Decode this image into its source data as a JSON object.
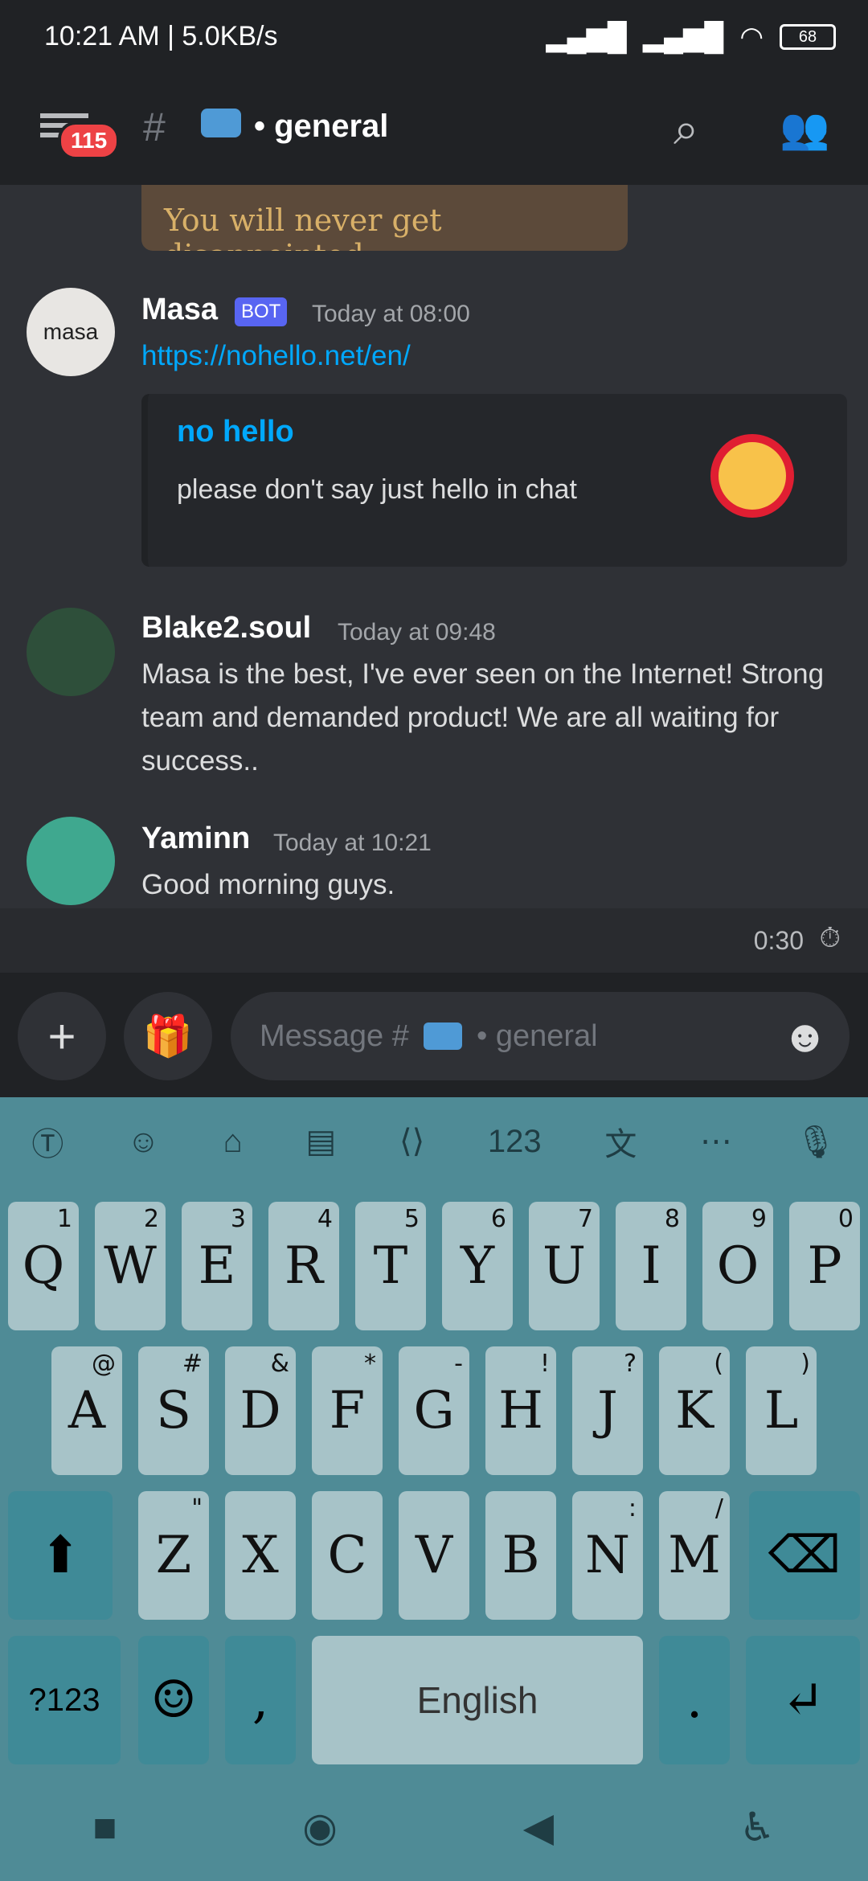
{
  "status": {
    "time": "10:21 AM | 5.0KB/s",
    "battery": "68"
  },
  "appbar": {
    "notification_count": "115",
    "channel": "• general"
  },
  "messages": [
    {
      "image_caption": "You will never get disappointed"
    },
    {
      "author": "Masa",
      "bot_label": "BOT",
      "timestamp": "Today at 08:00",
      "link": "https://nohello.net/en/",
      "embed_title": "no hello",
      "embed_desc": "please don't say just hello in chat",
      "avatar_text": "masa"
    },
    {
      "author": "Blake2.soul",
      "timestamp": "Today at 09:48",
      "text": "Masa is the best, I've ever seen on the Internet! Strong team and demanded product! We are all waiting for success.."
    },
    {
      "author": "Yaminn",
      "timestamp": "Today at 10:21",
      "text": "Good morning guys."
    }
  ],
  "composer": {
    "slowmode_timer": "0:30",
    "placeholder": "Message #",
    "placeholder_suffix": "• general"
  },
  "keyboard": {
    "row1": [
      {
        "k": "Q",
        "h": "1"
      },
      {
        "k": "W",
        "h": "2"
      },
      {
        "k": "E",
        "h": "3"
      },
      {
        "k": "R",
        "h": "4"
      },
      {
        "k": "T",
        "h": "5"
      },
      {
        "k": "Y",
        "h": "6"
      },
      {
        "k": "U",
        "h": "7"
      },
      {
        "k": "I",
        "h": "8"
      },
      {
        "k": "O",
        "h": "9"
      },
      {
        "k": "P",
        "h": "0"
      }
    ],
    "row2": [
      {
        "k": "A",
        "h": "@"
      },
      {
        "k": "S",
        "h": "#"
      },
      {
        "k": "D",
        "h": "&"
      },
      {
        "k": "F",
        "h": "*"
      },
      {
        "k": "G",
        "h": "-"
      },
      {
        "k": "H",
        "h": "!"
      },
      {
        "k": "J",
        "h": "?"
      },
      {
        "k": "K",
        "h": "("
      },
      {
        "k": "L",
        "h": ")"
      }
    ],
    "row3": [
      {
        "k": "Z",
        "h": "\""
      },
      {
        "k": "X",
        "h": ""
      },
      {
        "k": "C",
        "h": ""
      },
      {
        "k": "V",
        "h": ""
      },
      {
        "k": "B",
        "h": ""
      },
      {
        "k": "N",
        "h": ":"
      },
      {
        "k": "M",
        "h": "/"
      }
    ],
    "symbols": "?123",
    "comma": ",",
    "space": "English",
    "period": "."
  }
}
